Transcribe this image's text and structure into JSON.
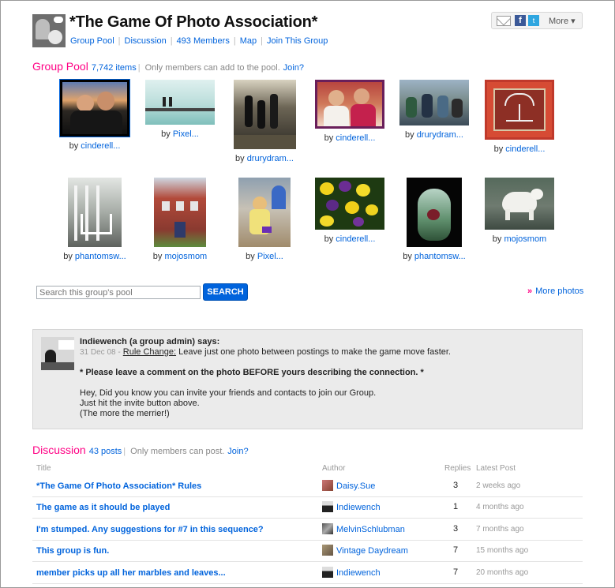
{
  "group": {
    "title": "*The Game Of Photo Association*",
    "nav": [
      {
        "label": "Group Pool"
      },
      {
        "label": "Discussion"
      },
      {
        "label": "493 Members"
      },
      {
        "label": "Map"
      },
      {
        "label": "Join This Group"
      }
    ]
  },
  "share": {
    "facebook_glyph": "f",
    "twitter_glyph": "t",
    "more_label": "More ▾"
  },
  "pool": {
    "heading": "Group Pool",
    "count": "7,742 items",
    "note": "Only members can add to the pool.",
    "join": "Join?",
    "photos": [
      {
        "by": "by",
        "user": "cinderell..."
      },
      {
        "by": "by",
        "user": "Pixel..."
      },
      {
        "by": "by",
        "user": "drurydram..."
      },
      {
        "by": "by",
        "user": "cinderell..."
      },
      {
        "by": "by",
        "user": "drurydram..."
      },
      {
        "by": "by",
        "user": "cinderell..."
      },
      {
        "by": "by",
        "user": "phantomsw..."
      },
      {
        "by": "by",
        "user": "mojosmom"
      },
      {
        "by": "by",
        "user": "Pixel..."
      },
      {
        "by": "by",
        "user": "cinderell..."
      },
      {
        "by": "by",
        "user": "phantomsw..."
      },
      {
        "by": "by",
        "user": "mojosmom"
      }
    ],
    "search_placeholder": "Search this group's pool",
    "search_button": "SEARCH",
    "more_photos": "More photos",
    "more_photos_arrow": "»"
  },
  "admin": {
    "says": "Indiewench (a group admin) says:",
    "date": "31 Dec 08 -",
    "rule_label": "Rule Change:",
    "rule_text": "Leave just one photo between postings to make the game move faster.",
    "bold_note": "* Please leave a comment on the photo BEFORE yours describing the connection. *",
    "line1": "Hey, Did you know you can invite your friends and contacts to join our Group.",
    "line2": "Just hit the invite button above.",
    "line3": "(The more the merrier!)"
  },
  "discussion": {
    "heading": "Discussion",
    "count": "43 posts",
    "note": "Only members can post.",
    "join": "Join?",
    "columns": {
      "title": "Title",
      "author": "Author",
      "replies": "Replies",
      "latest": "Latest Post"
    },
    "rows": [
      {
        "title": "*The Game Of Photo Association* Rules",
        "author": "Daisy.Sue",
        "replies": "3",
        "latest": "2 weeks ago"
      },
      {
        "title": "The game as it should be played",
        "author": "Indiewench",
        "replies": "1",
        "latest": "4 months ago"
      },
      {
        "title": "I'm stumped. Any suggestions for #7 in this sequence?",
        "author": "MelvinSchlubman",
        "replies": "3",
        "latest": "7 months ago"
      },
      {
        "title": "This group is fun.",
        "author": "Vintage Daydream",
        "replies": "7",
        "latest": "15 months ago"
      },
      {
        "title": "member picks up all her marbles and leaves...",
        "author": "Indiewench",
        "replies": "7",
        "latest": "20 months ago"
      }
    ]
  }
}
